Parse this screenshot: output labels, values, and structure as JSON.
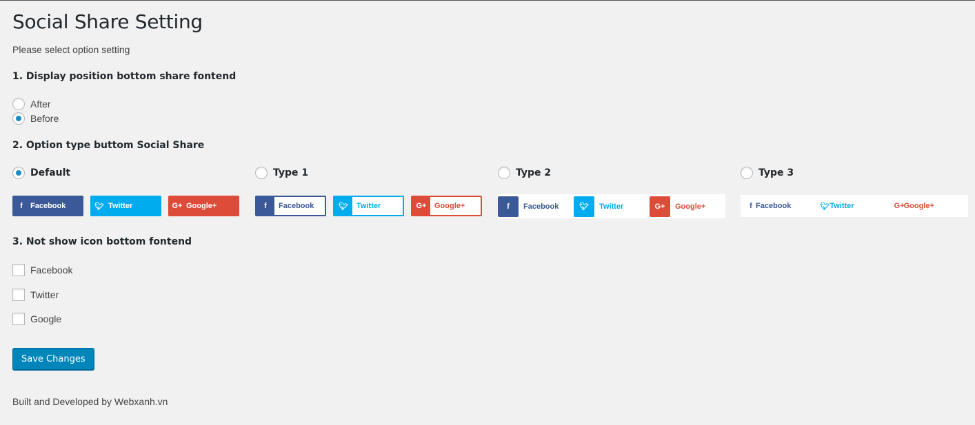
{
  "page": {
    "title": "Social Share Setting",
    "description": "Please select option setting"
  },
  "section1": {
    "heading": "1. Display position bottom share fontend",
    "options": [
      {
        "label": "After",
        "checked": false
      },
      {
        "label": "Before",
        "checked": true
      }
    ]
  },
  "section2": {
    "heading": "2. Option type buttom Social Share",
    "types": [
      {
        "label": "Default",
        "checked": true
      },
      {
        "label": "Type 1",
        "checked": false
      },
      {
        "label": "Type 2",
        "checked": false
      },
      {
        "label": "Type 3",
        "checked": false
      }
    ],
    "buttons": {
      "facebook": "Facebook",
      "twitter": "Twitter",
      "google": "Google+",
      "facebook_icon": "f",
      "google_icon": "G+"
    }
  },
  "section3": {
    "heading": "3. Not show icon bottom fontend",
    "options": [
      {
        "label": "Facebook",
        "checked": false
      },
      {
        "label": "Twitter",
        "checked": false
      },
      {
        "label": "Google",
        "checked": false
      }
    ]
  },
  "actions": {
    "save_label": "Save Changes"
  },
  "footer": {
    "text": "Built and Developed by Webxanh.vn"
  },
  "colors": {
    "facebook": "#3b5998",
    "twitter": "#00aced",
    "google": "#dd4b39",
    "primary_button": "#0085ba",
    "radio_dot": "#1e8cbe"
  }
}
